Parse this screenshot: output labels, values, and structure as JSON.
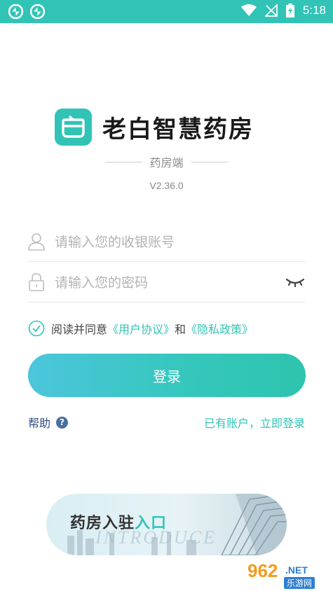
{
  "status_bar": {
    "time": "5:18",
    "background": "#31c4b6"
  },
  "app": {
    "name": "老白智慧药房",
    "subtitle": "药房端",
    "version": "V2.36.0"
  },
  "login_form": {
    "account_placeholder": "请输入您的收银账号",
    "password_placeholder": "请输入您的密码",
    "agree_prefix": "阅读并同意",
    "user_agreement": "《用户协议》",
    "conjunction": "和",
    "privacy_policy": "《隐私政策》",
    "login_button": "登录"
  },
  "links": {
    "help": "帮助",
    "help_badge": "?",
    "have_account": "已有账户，立即登录"
  },
  "banner": {
    "title_main": "药房入驻",
    "title_accent": "入口",
    "watermark": "INTRODUCE"
  },
  "watermark": {
    "number": "962",
    "domain": ".NET",
    "site": "乐游网"
  },
  "colors": {
    "accent": "#31c4b6",
    "help_text": "#2d4e7e",
    "button_start": "#4cc6dc",
    "button_end": "#2ec4ad"
  }
}
